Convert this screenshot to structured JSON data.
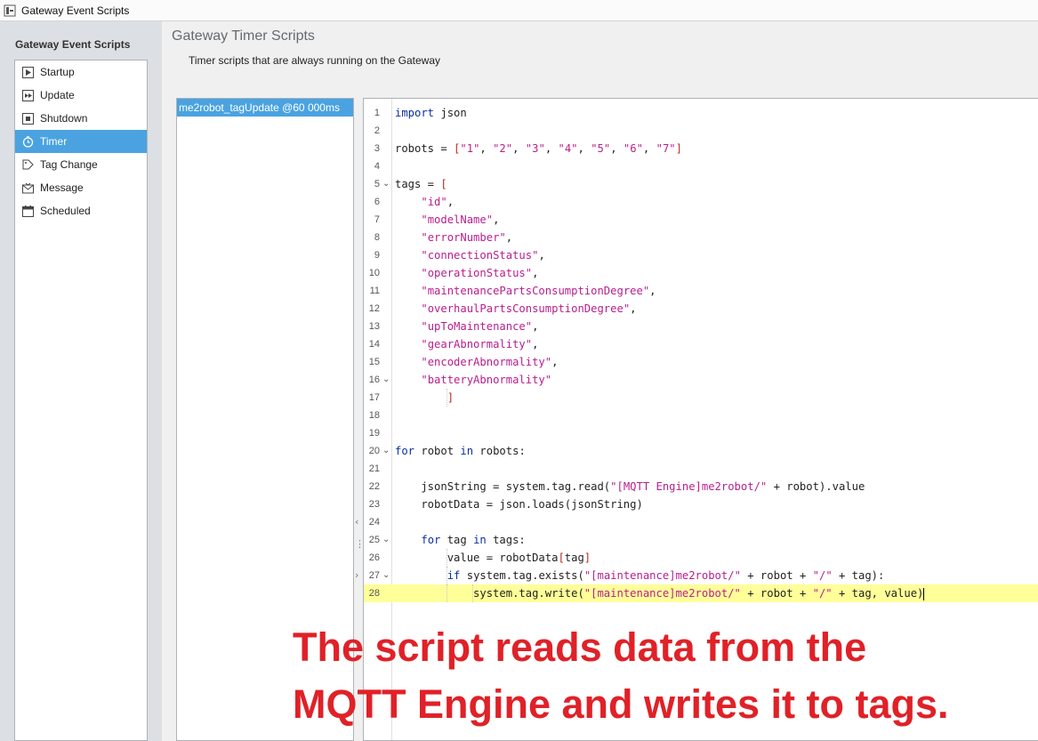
{
  "window": {
    "title": "Gateway Event Scripts"
  },
  "sidebar": {
    "heading": "Gateway Event Scripts",
    "items": [
      {
        "label": "Startup",
        "icon": "startup-icon",
        "selected": false
      },
      {
        "label": "Update",
        "icon": "update-icon",
        "selected": false
      },
      {
        "label": "Shutdown",
        "icon": "shutdown-icon",
        "selected": false
      },
      {
        "label": "Timer",
        "icon": "timer-icon",
        "selected": true
      },
      {
        "label": "Tag Change",
        "icon": "tag-change-icon",
        "selected": false
      },
      {
        "label": "Message",
        "icon": "message-icon",
        "selected": false
      },
      {
        "label": "Scheduled",
        "icon": "calendar-icon",
        "selected": false
      }
    ]
  },
  "main": {
    "title": "Gateway Timer Scripts",
    "description": "Timer scripts that are always running on the Gateway",
    "scripts": [
      {
        "label": "me2robot_tagUpdate @60 000ms",
        "selected": true
      }
    ]
  },
  "editor": {
    "highlighted_line": 28,
    "lines": [
      {
        "n": "1",
        "fold": false,
        "indent": 0,
        "tokens": [
          [
            "kw",
            "import"
          ],
          [
            "plain",
            " json"
          ]
        ]
      },
      {
        "n": "2",
        "fold": false,
        "indent": 0,
        "tokens": []
      },
      {
        "n": "3",
        "fold": false,
        "indent": 0,
        "tokens": [
          [
            "plain",
            "robots = "
          ],
          [
            "br",
            "["
          ],
          [
            "str",
            "\"1\""
          ],
          [
            "plain",
            ", "
          ],
          [
            "str",
            "\"2\""
          ],
          [
            "plain",
            ", "
          ],
          [
            "str",
            "\"3\""
          ],
          [
            "plain",
            ", "
          ],
          [
            "str",
            "\"4\""
          ],
          [
            "plain",
            ", "
          ],
          [
            "str",
            "\"5\""
          ],
          [
            "plain",
            ", "
          ],
          [
            "str",
            "\"6\""
          ],
          [
            "plain",
            ", "
          ],
          [
            "str",
            "\"7\""
          ],
          [
            "br",
            "]"
          ]
        ]
      },
      {
        "n": "4",
        "fold": false,
        "indent": 0,
        "tokens": []
      },
      {
        "n": "5",
        "fold": true,
        "indent": 0,
        "tokens": [
          [
            "plain",
            "tags = "
          ],
          [
            "br",
            "["
          ]
        ]
      },
      {
        "n": "6",
        "fold": false,
        "indent": 1,
        "tokens": [
          [
            "plain",
            "    "
          ],
          [
            "str",
            "\"id\""
          ],
          [
            "plain",
            ","
          ]
        ]
      },
      {
        "n": "7",
        "fold": false,
        "indent": 1,
        "tokens": [
          [
            "plain",
            "    "
          ],
          [
            "str",
            "\"modelName\""
          ],
          [
            "plain",
            ","
          ]
        ]
      },
      {
        "n": "8",
        "fold": false,
        "indent": 1,
        "tokens": [
          [
            "plain",
            "    "
          ],
          [
            "str",
            "\"errorNumber\""
          ],
          [
            "plain",
            ","
          ]
        ]
      },
      {
        "n": "9",
        "fold": false,
        "indent": 1,
        "tokens": [
          [
            "plain",
            "    "
          ],
          [
            "str",
            "\"connectionStatus\""
          ],
          [
            "plain",
            ","
          ]
        ]
      },
      {
        "n": "10",
        "fold": false,
        "indent": 1,
        "tokens": [
          [
            "plain",
            "    "
          ],
          [
            "str",
            "\"operationStatus\""
          ],
          [
            "plain",
            ","
          ]
        ]
      },
      {
        "n": "11",
        "fold": false,
        "indent": 1,
        "tokens": [
          [
            "plain",
            "    "
          ],
          [
            "str",
            "\"maintenancePartsConsumptionDegree\""
          ],
          [
            "plain",
            ","
          ]
        ]
      },
      {
        "n": "12",
        "fold": false,
        "indent": 1,
        "tokens": [
          [
            "plain",
            "    "
          ],
          [
            "str",
            "\"overhaulPartsConsumptionDegree\""
          ],
          [
            "plain",
            ","
          ]
        ]
      },
      {
        "n": "13",
        "fold": false,
        "indent": 1,
        "tokens": [
          [
            "plain",
            "    "
          ],
          [
            "str",
            "\"upToMaintenance\""
          ],
          [
            "plain",
            ","
          ]
        ]
      },
      {
        "n": "14",
        "fold": false,
        "indent": 1,
        "tokens": [
          [
            "plain",
            "    "
          ],
          [
            "str",
            "\"gearAbnormality\""
          ],
          [
            "plain",
            ","
          ]
        ]
      },
      {
        "n": "15",
        "fold": false,
        "indent": 1,
        "tokens": [
          [
            "plain",
            "    "
          ],
          [
            "str",
            "\"encoderAbnormality\""
          ],
          [
            "plain",
            ","
          ]
        ]
      },
      {
        "n": "16",
        "fold": true,
        "indent": 1,
        "tokens": [
          [
            "plain",
            "    "
          ],
          [
            "str",
            "\"batteryAbnormality\""
          ]
        ]
      },
      {
        "n": "17",
        "fold": false,
        "indent": 2,
        "tokens": [
          [
            "plain",
            "        "
          ],
          [
            "br",
            "]"
          ]
        ]
      },
      {
        "n": "18",
        "fold": false,
        "indent": 0,
        "tokens": []
      },
      {
        "n": "19",
        "fold": false,
        "indent": 0,
        "tokens": []
      },
      {
        "n": "20",
        "fold": true,
        "indent": 0,
        "tokens": [
          [
            "kw",
            "for"
          ],
          [
            "plain",
            " robot "
          ],
          [
            "kw",
            "in"
          ],
          [
            "plain",
            " robots:"
          ]
        ]
      },
      {
        "n": "21",
        "fold": false,
        "indent": 0,
        "tokens": []
      },
      {
        "n": "22",
        "fold": false,
        "indent": 1,
        "tokens": [
          [
            "plain",
            "    jsonString = system.tag.read("
          ],
          [
            "str",
            "\"[MQTT Engine]me2robot/\""
          ],
          [
            "plain",
            " + robot).value"
          ]
        ]
      },
      {
        "n": "23",
        "fold": false,
        "indent": 1,
        "tokens": [
          [
            "plain",
            "    robotData = json.loads(jsonString)"
          ]
        ]
      },
      {
        "n": "24",
        "fold": false,
        "indent": 0,
        "tokens": []
      },
      {
        "n": "25",
        "fold": true,
        "indent": 1,
        "tokens": [
          [
            "plain",
            "    "
          ],
          [
            "kw",
            "for"
          ],
          [
            "plain",
            " tag "
          ],
          [
            "kw",
            "in"
          ],
          [
            "plain",
            " tags:"
          ]
        ]
      },
      {
        "n": "26",
        "fold": false,
        "indent": 2,
        "tokens": [
          [
            "plain",
            "        value = robotData"
          ],
          [
            "br",
            "["
          ],
          [
            "plain",
            "tag"
          ],
          [
            "br",
            "]"
          ]
        ]
      },
      {
        "n": "27",
        "fold": true,
        "indent": 2,
        "tokens": [
          [
            "plain",
            "        "
          ],
          [
            "kw",
            "if"
          ],
          [
            "plain",
            " system.tag.exists("
          ],
          [
            "str",
            "\"[maintenance]me2robot/\""
          ],
          [
            "plain",
            " + robot + "
          ],
          [
            "str",
            "\"/\""
          ],
          [
            "plain",
            " + tag):"
          ]
        ]
      },
      {
        "n": "28",
        "fold": false,
        "indent": 3,
        "tokens": [
          [
            "plain",
            "            system.tag.write("
          ],
          [
            "str",
            "\"[maintenance]me2robot/\""
          ],
          [
            "plain",
            " + robot + "
          ],
          [
            "str",
            "\"/\""
          ],
          [
            "plain",
            " + tag, value)"
          ]
        ]
      }
    ]
  },
  "annotation": {
    "line1": "The script reads data from the",
    "line2": "MQTT Engine and writes it to tags."
  },
  "colors": {
    "selection": "#4aa3e0",
    "annotation": "#e02128",
    "highlight_line": "#ffff99"
  }
}
